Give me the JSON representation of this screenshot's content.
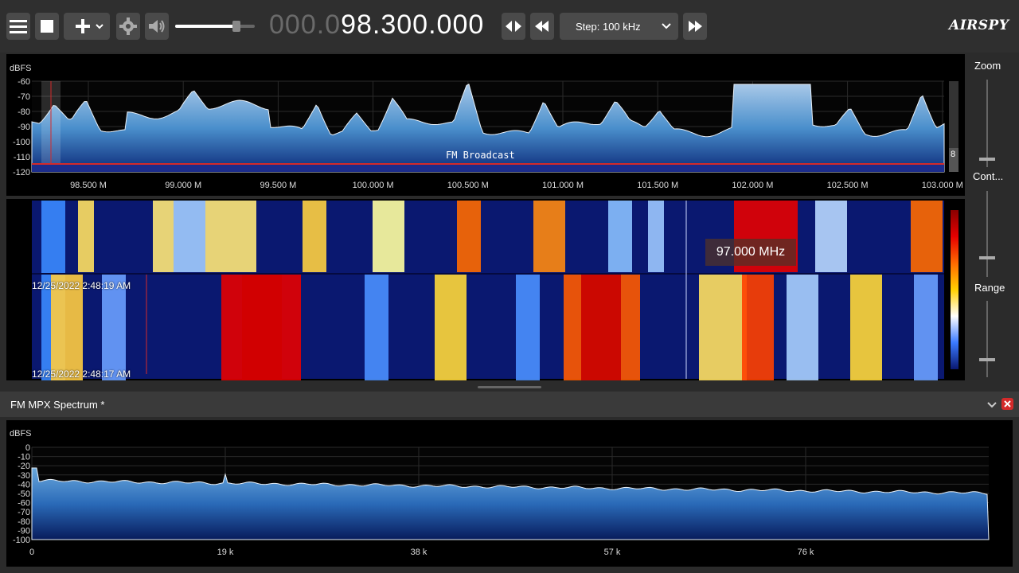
{
  "toolbar": {
    "frequency_dim": "000.0",
    "frequency_main": "98.300.000",
    "step_label": "Step: 100 kHz",
    "logo": "AIRSPY"
  },
  "spectrum": {
    "unit": "dBFS",
    "y_ticks": [
      "-60",
      "-70",
      "-80",
      "-90",
      "-100",
      "-110",
      "-120"
    ],
    "x_ticks": [
      "98.500 M",
      "99.000 M",
      "99.500 M",
      "100.000 M",
      "100.500 M",
      "101.000 M",
      "101.500 M",
      "102.000 M",
      "102.500 M",
      "103.000 M"
    ],
    "band_label": "FM Broadcast",
    "scroll_value": "8"
  },
  "waterfall": {
    "timestamp_top": "12/25/2022 2:48:19 AM",
    "timestamp_bottom": "12/25/2022 2:48:17 AM",
    "tooltip": "97.000 MHz"
  },
  "side": {
    "zoom_label": "Zoom",
    "contrast_label": "Cont...",
    "range_label": "Range"
  },
  "mpx_panel": {
    "title": "FM MPX Spectrum *",
    "unit": "dBFS",
    "y_ticks": [
      "0",
      "-10",
      "-20",
      "-30",
      "-40",
      "-50",
      "-60",
      "-70",
      "-80",
      "-90",
      "-100"
    ],
    "x_ticks": [
      "0",
      "19 k",
      "38 k",
      "57 k",
      "76 k"
    ]
  },
  "colors": {
    "accent_red": "#d42a2a",
    "spectrum_fill": "#4a8fcc",
    "background": "#000000"
  }
}
